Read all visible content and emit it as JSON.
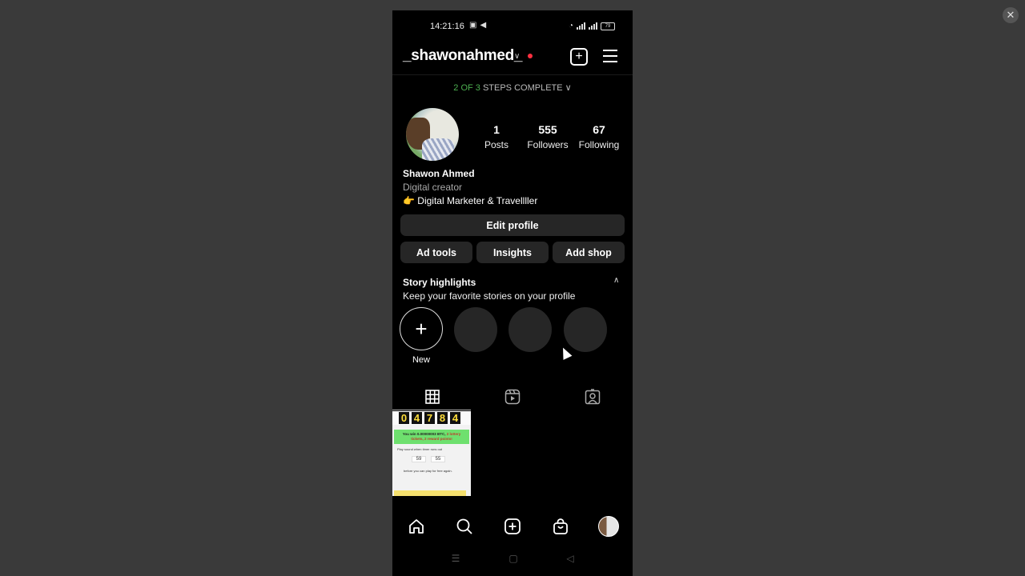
{
  "status_bar": {
    "time": "14:21:16",
    "battery": "79"
  },
  "header": {
    "username": "_shawonahmed_"
  },
  "steps": {
    "done": "2 OF 3",
    "label": "STEPS COMPLETE"
  },
  "stats": [
    {
      "value": "1",
      "label": "Posts"
    },
    {
      "value": "555",
      "label": "Followers"
    },
    {
      "value": "67",
      "label": "Following"
    }
  ],
  "bio": {
    "name": "Shawon Ahmed",
    "category": "Digital creator",
    "text": "👉 Digital Marketer & Travellller"
  },
  "buttons": {
    "edit_profile": "Edit profile",
    "ad_tools": "Ad tools",
    "insights": "Insights",
    "add_shop": "Add shop"
  },
  "highlights": {
    "title": "Story highlights",
    "subtitle": "Keep your favorite stories on your profile",
    "new_label": "New"
  },
  "post": {
    "counter": [
      "0",
      "4",
      "7",
      "8",
      "4"
    ],
    "win_text": "You win 0.00000003 BTC,",
    "win_reward": "2 lottery tickets, 2 reward points!",
    "sound_text": "Play sound when timer runs out",
    "minutes": "59",
    "seconds": "55",
    "footer": "before you can play for free again."
  },
  "close_label": "✕"
}
